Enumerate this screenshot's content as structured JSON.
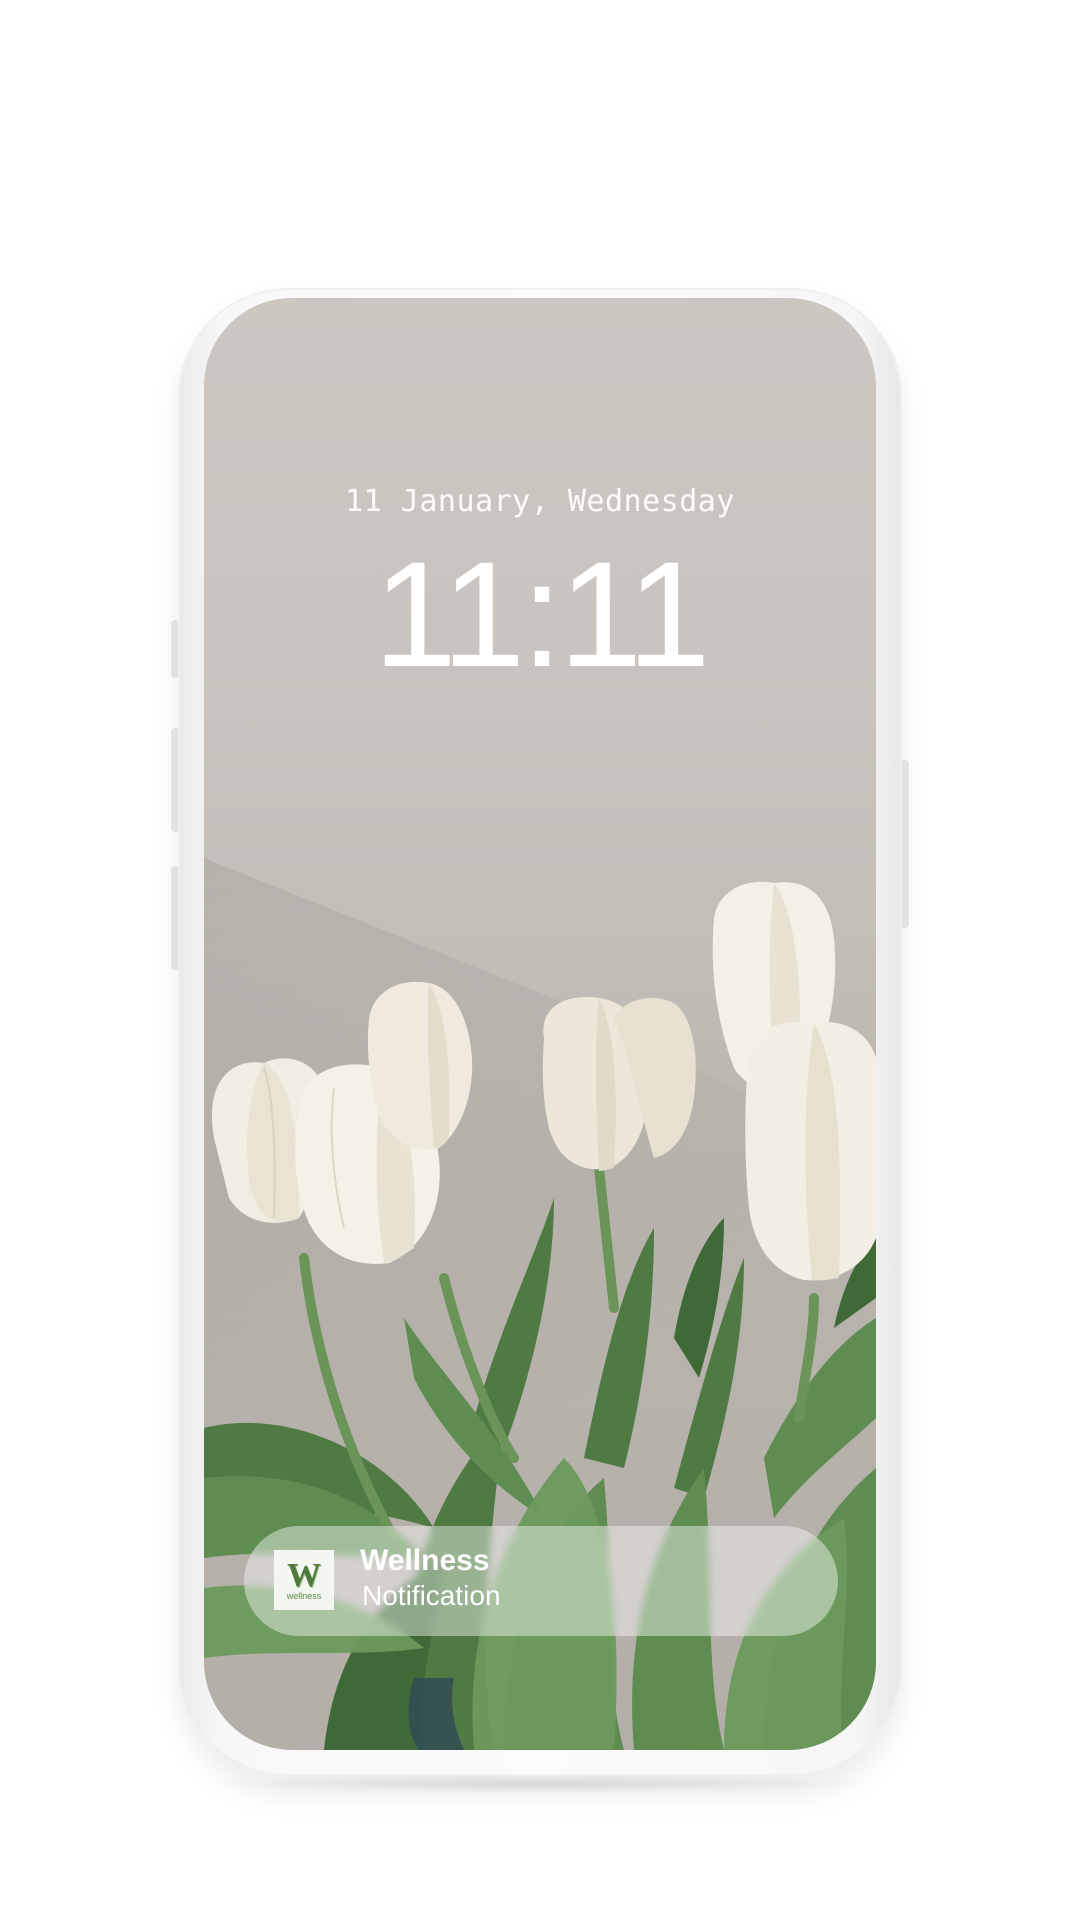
{
  "lock_screen": {
    "date": "11 January, Wednesday",
    "time": "11:11"
  },
  "notification": {
    "app_icon": {
      "icon_name": "wellness-app-icon",
      "letter": "W",
      "caption": "wellness",
      "color": "#4e7a3c"
    },
    "title": "Wellness",
    "body": "Notification"
  },
  "wallpaper": {
    "subject": "white-tulips-icon"
  }
}
